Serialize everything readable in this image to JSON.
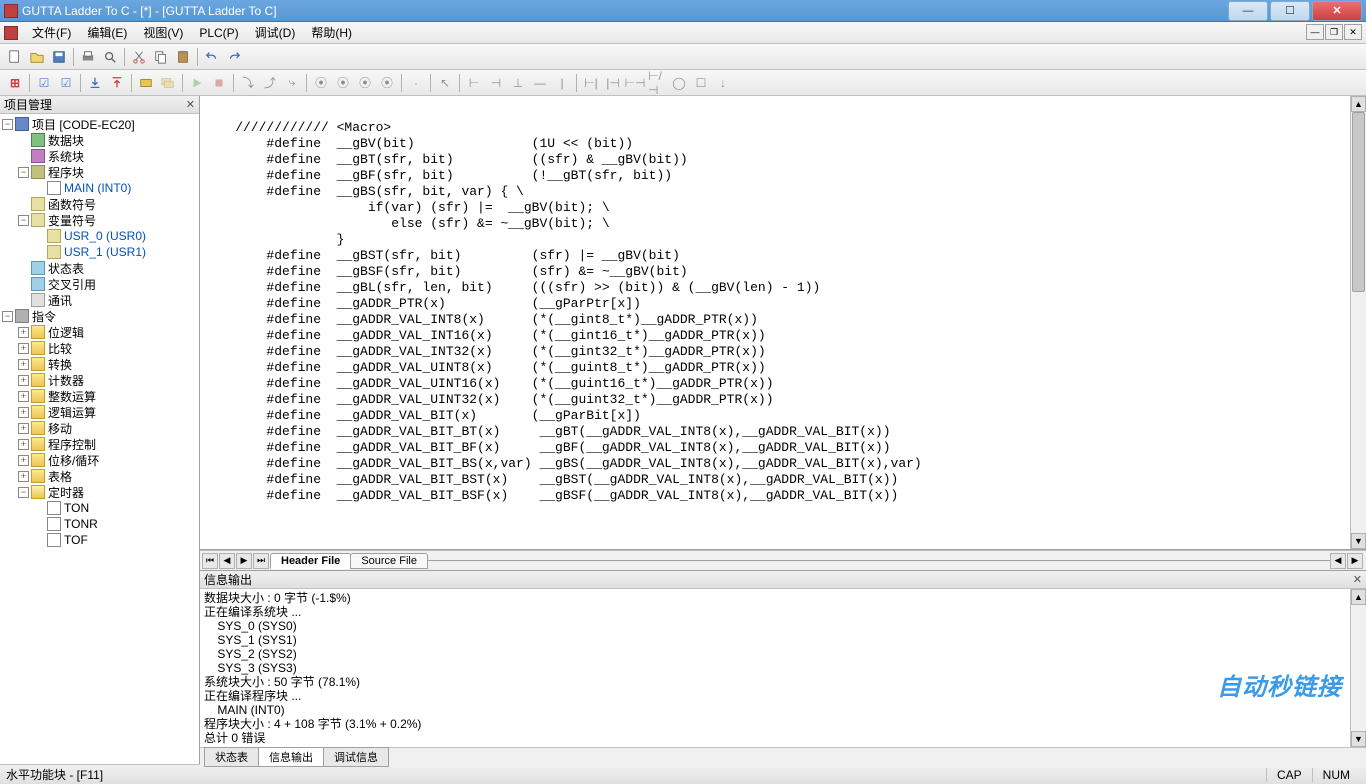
{
  "title": "GUTTA Ladder To C - [*] - [GUTTA Ladder To C]",
  "menus": [
    "文件(F)",
    "编辑(E)",
    "视图(V)",
    "PLC(P)",
    "调试(D)",
    "帮助(H)"
  ],
  "panels": {
    "project": "项目管理",
    "output": "信息输出"
  },
  "tree": {
    "root": "项目 [CODE-EC20]",
    "datablock": "数据块",
    "sysblock": "系统块",
    "progblock": "程序块",
    "main": "MAIN (INT0)",
    "funcsym": "函数符号",
    "varsym": "变量符号",
    "usr0": "USR_0 (USR0)",
    "usr1": "USR_1 (USR1)",
    "status": "状态表",
    "cross": "交叉引用",
    "comm": "通讯",
    "instr": "指令",
    "bitlogic": "位逻辑",
    "compare": "比较",
    "convert": "转换",
    "counter": "计数器",
    "intmath": "整数运算",
    "logicmath": "逻辑运算",
    "move": "移动",
    "progctl": "程序控制",
    "shift": "位移/循环",
    "table": "表格",
    "timer": "定时器",
    "ton": "TON",
    "tonr": "TONR",
    "tof": "TOF"
  },
  "code_lines": [
    "",
    "    //////////// <Macro>",
    "        #define  __gBV(bit)               (1U << (bit))",
    "        #define  __gBT(sfr, bit)          ((sfr) & __gBV(bit))",
    "        #define  __gBF(sfr, bit)          (!__gBT(sfr, bit))",
    "        #define  __gBS(sfr, bit, var) { \\",
    "                     if(var) (sfr) |=  __gBV(bit); \\",
    "                        else (sfr) &= ~__gBV(bit); \\",
    "                 }",
    "        #define  __gBST(sfr, bit)         (sfr) |= __gBV(bit)",
    "        #define  __gBSF(sfr, bit)         (sfr) &= ~__gBV(bit)",
    "        #define  __gBL(sfr, len, bit)     (((sfr) >> (bit)) & (__gBV(len) - 1))",
    "        #define  __gADDR_PTR(x)           (__gParPtr[x])",
    "        #define  __gADDR_VAL_INT8(x)      (*(__gint8_t*)__gADDR_PTR(x))",
    "        #define  __gADDR_VAL_INT16(x)     (*(__gint16_t*)__gADDR_PTR(x))",
    "        #define  __gADDR_VAL_INT32(x)     (*(__gint32_t*)__gADDR_PTR(x))",
    "        #define  __gADDR_VAL_UINT8(x)     (*(__guint8_t*)__gADDR_PTR(x))",
    "        #define  __gADDR_VAL_UINT16(x)    (*(__guint16_t*)__gADDR_PTR(x))",
    "        #define  __gADDR_VAL_UINT32(x)    (*(__guint32_t*)__gADDR_PTR(x))",
    "        #define  __gADDR_VAL_BIT(x)       (__gParBit[x])",
    "        #define  __gADDR_VAL_BIT_BT(x)     __gBT(__gADDR_VAL_INT8(x),__gADDR_VAL_BIT(x))",
    "        #define  __gADDR_VAL_BIT_BF(x)     __gBF(__gADDR_VAL_INT8(x),__gADDR_VAL_BIT(x))",
    "        #define  __gADDR_VAL_BIT_BS(x,var) __gBS(__gADDR_VAL_INT8(x),__gADDR_VAL_BIT(x),var)",
    "        #define  __gADDR_VAL_BIT_BST(x)    __gBST(__gADDR_VAL_INT8(x),__gADDR_VAL_BIT(x))",
    "        #define  __gADDR_VAL_BIT_BSF(x)    __gBSF(__gADDR_VAL_INT8(x),__gADDR_VAL_BIT(x))"
  ],
  "file_tabs": {
    "header": "Header File",
    "source": "Source File"
  },
  "output_lines": [
    "数据块大小 : 0 字节 (-1.$%)",
    "正在编译系统块 ...",
    "    SYS_0 (SYS0)",
    "    SYS_1 (SYS1)",
    "    SYS_2 (SYS2)",
    "    SYS_3 (SYS3)",
    "系统块大小 : 50 字节 (78.1%)",
    "正在编译程序块 ...",
    "    MAIN (INT0)",
    "程序块大小 : 4 + 108 字节 (3.1% + 0.2%)",
    "总计 0 错误"
  ],
  "bottom_tabs": {
    "status": "状态表",
    "output": "信息输出",
    "debug": "调试信息"
  },
  "statusbar": {
    "left": "水平功能块  -  [F11]",
    "cap": "CAP",
    "num": "NUM"
  },
  "watermark": "自动秒链接"
}
